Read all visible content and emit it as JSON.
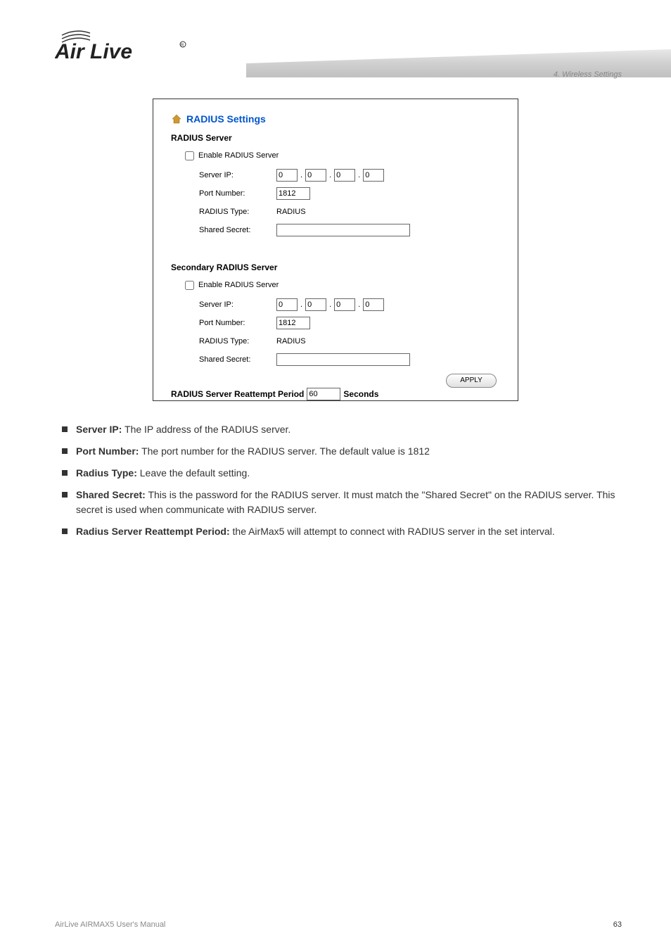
{
  "chapter_label": "4. Wireless Settings",
  "panel": {
    "title": "RADIUS Settings",
    "primary": {
      "heading": "RADIUS Server",
      "enable_label": "Enable RADIUS Server",
      "enable_checked": false,
      "server_ip_label": "Server IP:",
      "server_ip": [
        "0",
        "0",
        "0",
        "0"
      ],
      "port_label": "Port Number:",
      "port_value": "1812",
      "type_label": "RADIUS Type:",
      "type_value": "RADIUS",
      "secret_label": "Shared Secret:",
      "secret_value": ""
    },
    "secondary": {
      "heading": "Secondary RADIUS Server",
      "enable_label": "Enable RADIUS Server",
      "enable_checked": false,
      "server_ip_label": "Server IP:",
      "server_ip": [
        "0",
        "0",
        "0",
        "0"
      ],
      "port_label": "Port Number:",
      "port_value": "1812",
      "type_label": "RADIUS Type:",
      "type_value": "RADIUS",
      "secret_label": "Shared Secret:",
      "secret_value": ""
    },
    "reattempt_label_pre": "RADIUS Server Reattempt Period",
    "reattempt_value": "60",
    "reattempt_label_post": "Seconds",
    "apply_label": "APPLY"
  },
  "field_descriptions": [
    {
      "name": "Server IP:",
      "desc": " The IP address of the RADIUS server."
    },
    {
      "name": "Port Number:",
      "desc": " The port number for the RADIUS server. The default value is 1812"
    },
    {
      "name": "Radius Type:",
      "desc": " Leave the default setting."
    },
    {
      "name": "Shared Secret:",
      "desc": " This is the password for the RADIUS server. It must match the \"Shared Secret\" on the RADIUS server. This secret is used when communicate with RADIUS server."
    },
    {
      "name": "Radius Server Reattempt Period:",
      "desc": " the AirMax5 will attempt to connect with RADIUS server in the set interval."
    }
  ],
  "footer": "AirLive AIRMAX5 User's Manual",
  "page_number": "63"
}
